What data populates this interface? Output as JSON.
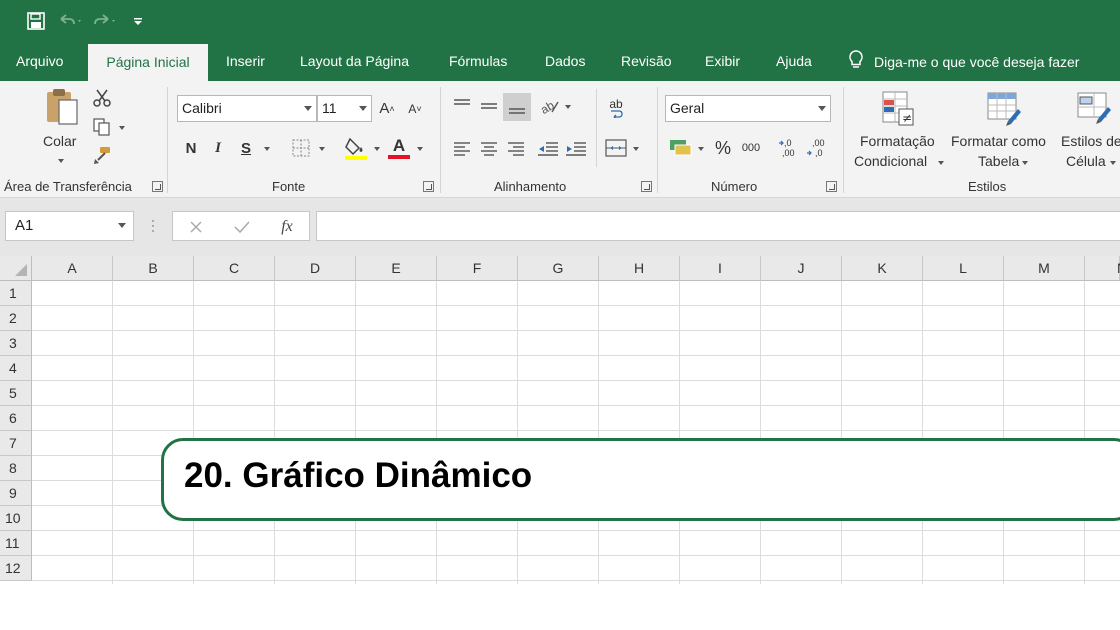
{
  "tabs": [
    {
      "label": "Arquivo"
    },
    {
      "label": "Página Inicial"
    },
    {
      "label": "Inserir"
    },
    {
      "label": "Layout da Página"
    },
    {
      "label": "Fórmulas"
    },
    {
      "label": "Dados"
    },
    {
      "label": "Revisão"
    },
    {
      "label": "Exibir"
    },
    {
      "label": "Ajuda"
    }
  ],
  "active_tab": "Página Inicial",
  "tell_me": "Diga-me o que você deseja fazer",
  "clipboard": {
    "paste_label": "Colar",
    "group_label": "Área de Transferência"
  },
  "font": {
    "name": "Calibri",
    "size": "11",
    "bold": "N",
    "italic": "I",
    "underline": "S",
    "grow": "A",
    "shrink": "A",
    "color_letter": "A",
    "group_label": "Fonte"
  },
  "alignment": {
    "wrap": "ab",
    "group_label": "Alinhamento"
  },
  "number": {
    "format": "Geral",
    "percent": "%",
    "thousands": "000",
    "inc_decimal": ",0\n,00",
    "dec_decimal": ",00\n,0",
    "group_label": "Número"
  },
  "styles": {
    "conditional_line1": "Formatação",
    "conditional_line2": "Condicional",
    "table_line1": "Formatar como",
    "table_line2": "Tabela",
    "cell_line1": "Estilos de",
    "cell_line2": "Célula",
    "group_label": "Estilos"
  },
  "formula_bar": {
    "name_box": "A1",
    "fx": "fx",
    "formula": ""
  },
  "columns": [
    "A",
    "B",
    "C",
    "D",
    "E",
    "F",
    "G",
    "H",
    "I",
    "J",
    "K",
    "L",
    "M",
    "N"
  ],
  "rows": [
    "1",
    "2",
    "3",
    "4",
    "5",
    "6",
    "7",
    "8",
    "9",
    "10",
    "11",
    "12"
  ],
  "callout": {
    "title": "20. Gráfico Dinâmico"
  },
  "colors": {
    "accent": "#217346",
    "ribbon": "#f3f3f3",
    "font_color_bar": "#e81123",
    "highlight_bar": "#ffff00"
  }
}
